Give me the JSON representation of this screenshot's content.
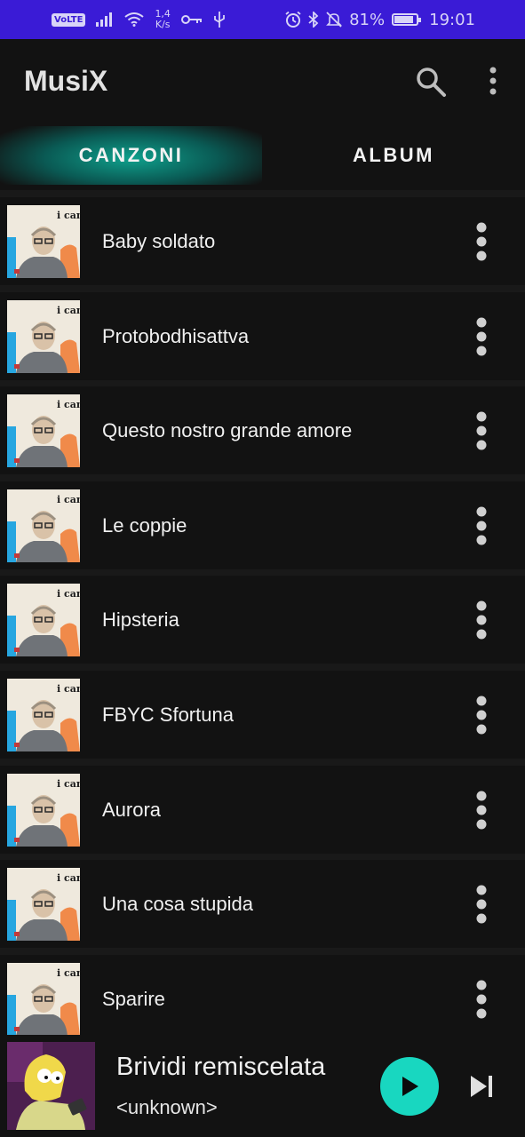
{
  "status_bar": {
    "volte": "VoLTE",
    "speed_value": "1,4",
    "speed_unit": "K/s",
    "battery": "81%",
    "time": "19:01"
  },
  "app_bar": {
    "title": "MusiX"
  },
  "tabs": [
    {
      "label": "CANZONI",
      "selected": true
    },
    {
      "label": "ALBUM",
      "selected": false
    }
  ],
  "album_art_text": "i cani",
  "songs": [
    "Baby soldato",
    "Protobodhisattva",
    "Questo nostro grande amore",
    "Le coppie",
    "Hipsteria",
    "FBYC Sfortuna",
    "Aurora",
    "Una cosa stupida",
    "Sparire"
  ],
  "now_playing": {
    "title": "Brividi remiscelata",
    "artist": "<unknown>"
  },
  "colors": {
    "status_bar": "#3a1bd6",
    "accent": "#18d7c0",
    "background": "#191919",
    "surface": "#121212"
  }
}
